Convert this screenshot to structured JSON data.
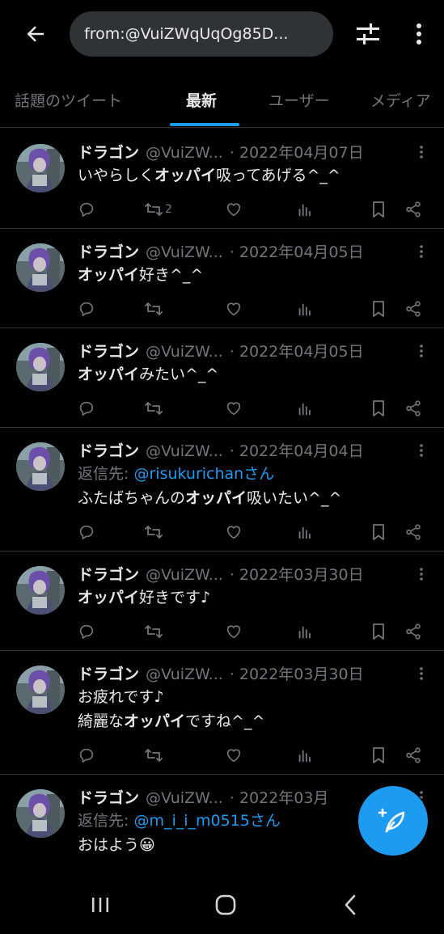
{
  "header": {
    "search_query": "from:@VuiZWqUqOg85D..."
  },
  "tabs": [
    {
      "label": "話題のツイート"
    },
    {
      "label": "最新"
    },
    {
      "label": "ユーザー"
    },
    {
      "label": "メディア"
    }
  ],
  "tweets": [
    {
      "name": "ドラゴン",
      "handle": "@VuiZW...",
      "date": "· 2022年04月07日",
      "reply_to_prefix": "",
      "reply_to_mention": "",
      "lines": [
        [
          "いやらしく",
          "オッパイ",
          "吸ってあげる^_^"
        ]
      ],
      "retweets": "2"
    },
    {
      "name": "ドラゴン",
      "handle": "@VuiZW...",
      "date": "· 2022年04月05日",
      "lines": [
        [
          "",
          "オッパイ",
          "好き^_^"
        ]
      ],
      "retweets": ""
    },
    {
      "name": "ドラゴン",
      "handle": "@VuiZW...",
      "date": "· 2022年04月05日",
      "lines": [
        [
          "",
          "オッパイ",
          "みたい^_^"
        ]
      ],
      "retweets": ""
    },
    {
      "name": "ドラゴン",
      "handle": "@VuiZW...",
      "date": "· 2022年04月04日",
      "reply_to_prefix": "返信先: ",
      "reply_to_mention": "@risukurichanさん",
      "lines": [
        [
          "ふたばちゃんの",
          "オッパイ",
          "吸いたい^_^"
        ]
      ],
      "retweets": ""
    },
    {
      "name": "ドラゴン",
      "handle": "@VuiZW...",
      "date": "· 2022年03月30日",
      "lines": [
        [
          "",
          "オッパイ",
          "好きです♪"
        ]
      ],
      "retweets": ""
    },
    {
      "name": "ドラゴン",
      "handle": "@VuiZW...",
      "date": "· 2022年03月30日",
      "lines": [
        [
          "お疲れです♪",
          "",
          ""
        ],
        [
          "綺麗な",
          "オッパイ",
          "ですね^_^"
        ]
      ],
      "retweets": ""
    },
    {
      "name": "ドラゴン",
      "handle": "@VuiZW...",
      "date": "· 2022年03月",
      "reply_to_prefix": "返信先: ",
      "reply_to_mention": "@m_i_i_m0515さん",
      "lines": [
        [
          "おはよう😀",
          "",
          ""
        ]
      ],
      "retweets": ""
    }
  ],
  "colors": {
    "accent": "#1d9bf0",
    "muted": "#71767b",
    "text": "#e7e9ea",
    "background": "#000000"
  },
  "icons": {
    "back": "arrow-left-icon",
    "filter": "sliders-icon",
    "more": "more-vertical-icon",
    "reply": "comment-icon",
    "retweet": "retweet-icon",
    "like": "heart-icon",
    "views": "bar-chart-icon",
    "bookmark": "bookmark-icon",
    "share": "share-icon",
    "compose": "feather-plus-icon"
  }
}
